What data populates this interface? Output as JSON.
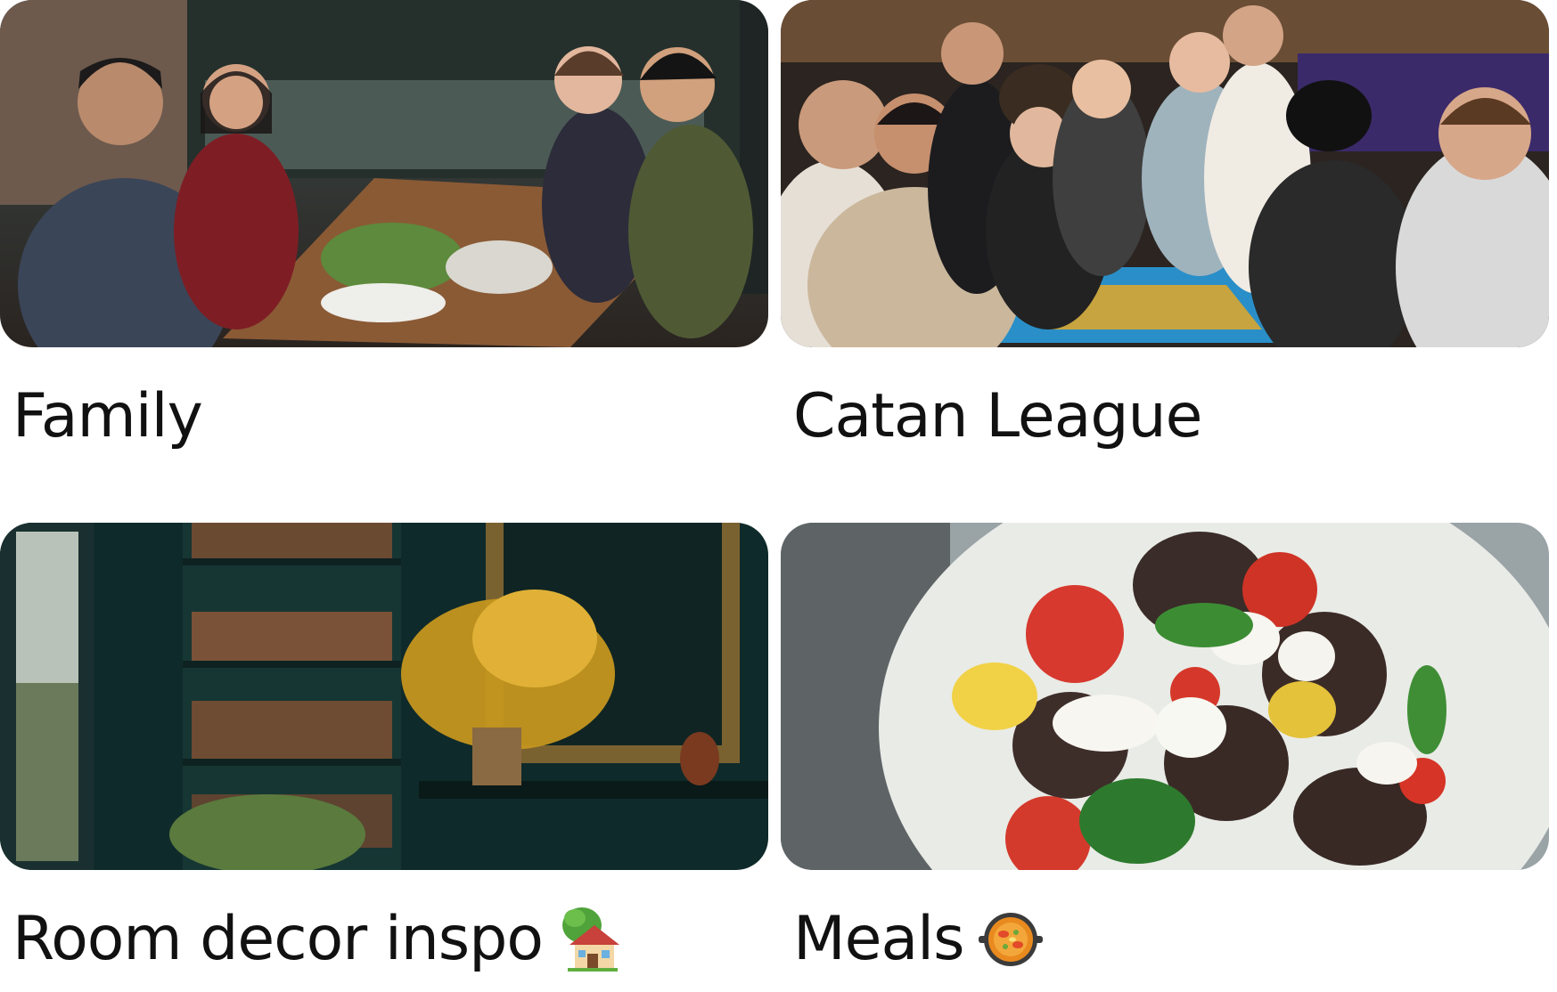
{
  "albums": [
    {
      "title": "Family",
      "emoji": "",
      "photo": "family-dinner-photo"
    },
    {
      "title": "Catan League",
      "emoji": "",
      "photo": "board-game-group-photo"
    },
    {
      "title": "Room decor inspo",
      "emoji": "house-with-tree-icon",
      "photo": "bookshelf-room-photo"
    },
    {
      "title": "Meals",
      "emoji": "paella-pan-icon",
      "photo": "eggplant-salad-photo"
    }
  ]
}
